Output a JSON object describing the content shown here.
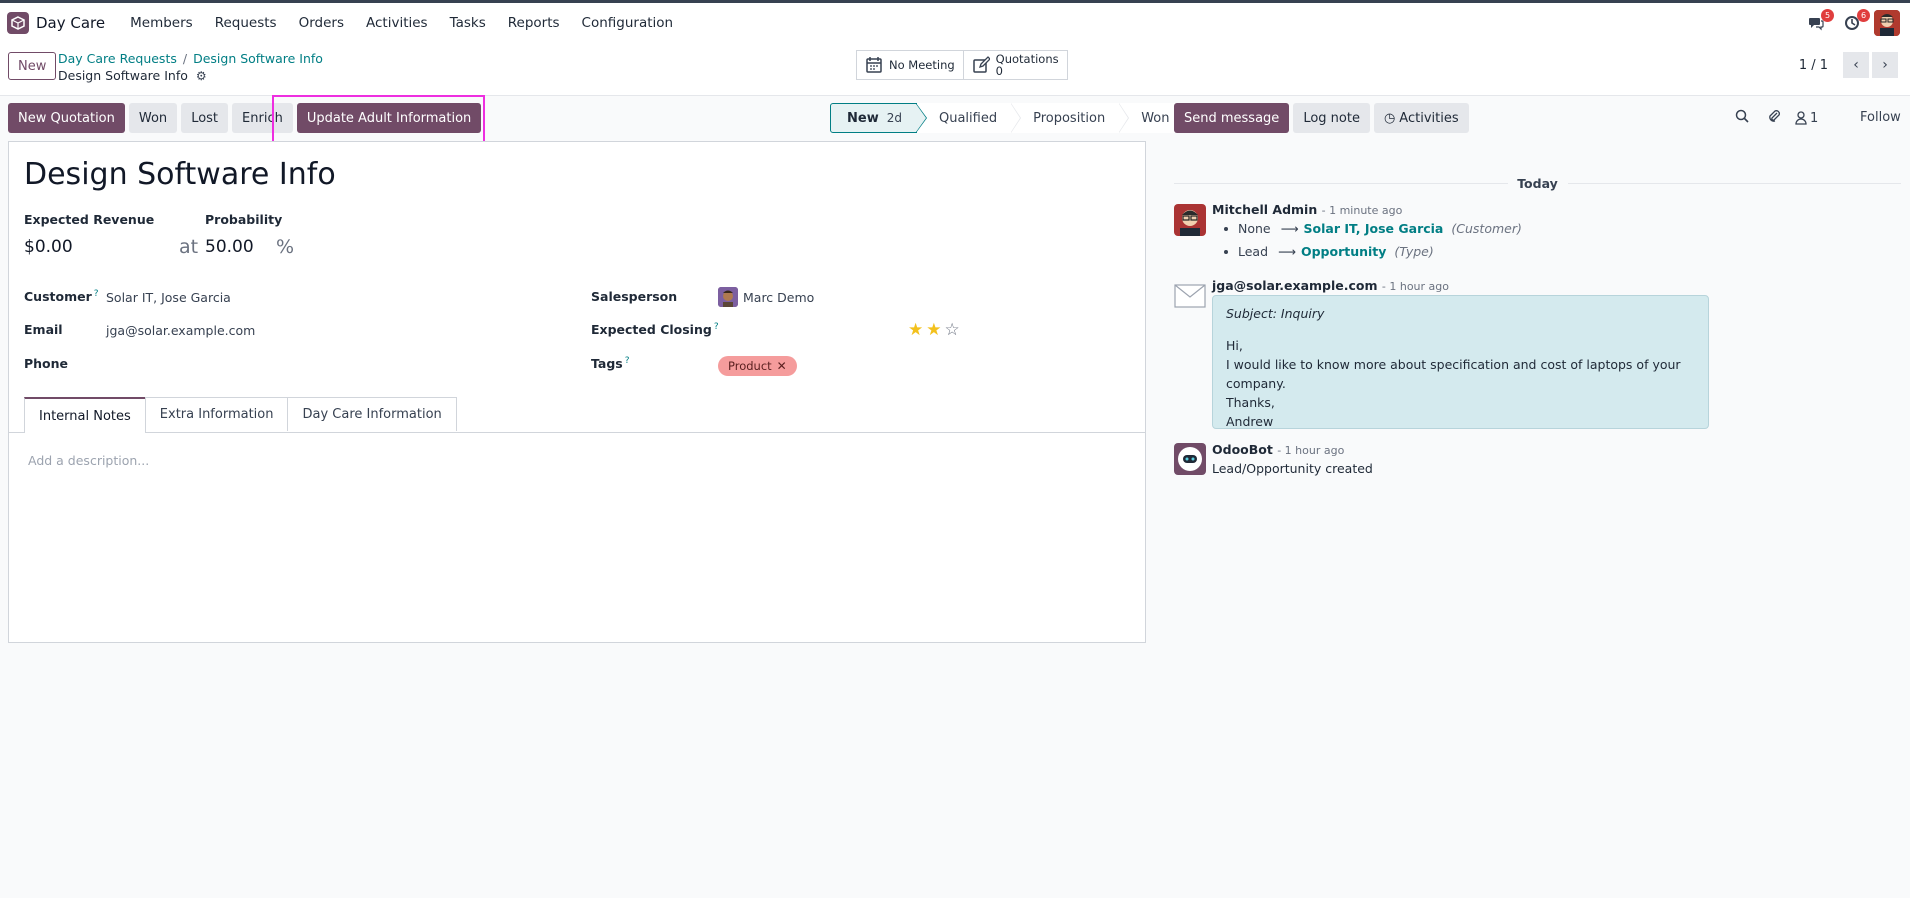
{
  "navbar": {
    "app_name": "Day Care",
    "menu": [
      "Members",
      "Requests",
      "Orders",
      "Activities",
      "Tasks",
      "Reports",
      "Configuration"
    ],
    "messages_badge": "5",
    "activities_badge": "6"
  },
  "control": {
    "new_label": "New",
    "breadcrumb": [
      "Day Care Requests",
      "Design Software Info"
    ],
    "current": "Design Software Info",
    "smart_buttons": {
      "meeting_label": "No Meeting",
      "quotations_label": "Quotations",
      "quotations_count": "0"
    },
    "pager": "1 / 1"
  },
  "actions": {
    "new_quotation": "New Quotation",
    "won": "Won",
    "lost": "Lost",
    "enrich": "Enrich",
    "update_adult": "Update Adult Information"
  },
  "statusbar": {
    "stages": [
      "New",
      "Qualified",
      "Proposition",
      "Won"
    ],
    "active_chip": "2d"
  },
  "form": {
    "title": "Design Software Info",
    "expected_revenue_label": "Expected Revenue",
    "expected_revenue": "$0.00",
    "at_label": "at",
    "probability_label": "Probability",
    "probability": "50.00",
    "percent": "%",
    "customer_label": "Customer",
    "customer": "Solar IT, Jose Garcia",
    "email_label": "Email",
    "email": "jga@solar.example.com",
    "phone_label": "Phone",
    "salesperson_label": "Salesperson",
    "salesperson": "Marc Demo",
    "expected_closing_label": "Expected Closing",
    "priority_stars": 2,
    "tags_label": "Tags",
    "tag": "Product",
    "help_mark": "?",
    "tabs": [
      "Internal Notes",
      "Extra Information",
      "Day Care Information"
    ],
    "description_placeholder": "Add a description..."
  },
  "chatter": {
    "send_message": "Send message",
    "log_note": "Log note",
    "activities": "Activities",
    "followers_count": "1",
    "follow": "Follow",
    "today": "Today",
    "messages": [
      {
        "author": "Mitchell Admin",
        "when": "- 1 minute ago",
        "tracking": [
          {
            "old": "None",
            "new": "Solar IT, Jose Garcia",
            "field": "(Customer)"
          },
          {
            "old": "Lead",
            "new": "Opportunity",
            "field": "(Type)"
          }
        ]
      },
      {
        "author": "jga@solar.example.com",
        "when": "- 1 hour ago",
        "subject": "Subject: Inquiry",
        "body": [
          "Hi,",
          "I would like to know more about specification and cost of laptops of your company.",
          "Thanks,",
          "Andrew"
        ]
      },
      {
        "author": "OdooBot",
        "when": "- 1 hour ago",
        "body": "Lead/Opportunity created"
      }
    ]
  },
  "colors": {
    "primary": "#714b67",
    "link": "#017e84",
    "highlight": "#ee2ee0",
    "tag": "#f59c9c",
    "mail_bubble": "#d4eaee"
  }
}
